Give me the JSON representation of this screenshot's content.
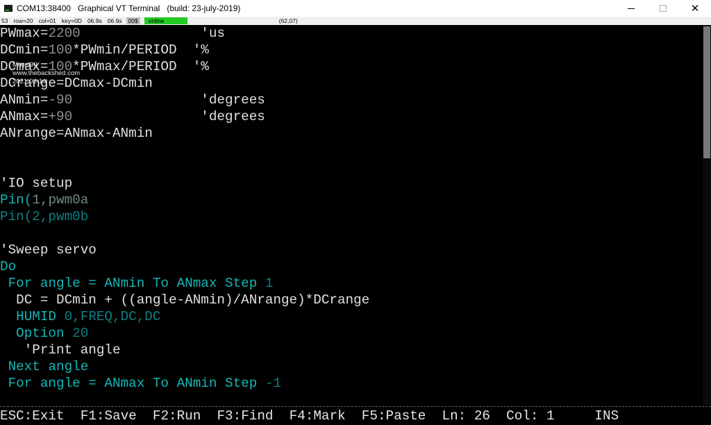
{
  "window": {
    "title": "COM13:38400   Graphical VT Terminal   (build: 23-july-2019)",
    "minimize": "",
    "maximize": "",
    "close": "✕"
  },
  "statusbar": {
    "items": [
      "53",
      "row=20",
      "col=01",
      "key=0D",
      "06.9s",
      "06.9s"
    ],
    "mode": "00$",
    "connection": "online",
    "cursor_pos": "(62,07)"
  },
  "watermark": {
    "author": "Mixtel90",
    "site": "www.thebackshed.com",
    "date": "2021-06-14"
  },
  "terminal": {
    "lines": [
      [
        {
          "t": "PWmax=",
          "c": "white"
        },
        {
          "t": "2200",
          "c": "gray"
        },
        {
          "t": "               'us",
          "c": "white"
        }
      ],
      [
        {
          "t": "DCmin=",
          "c": "white"
        },
        {
          "t": "100",
          "c": "gray"
        },
        {
          "t": "*PWmin/PERIOD",
          "c": "white"
        },
        {
          "t": "  '%",
          "c": "white"
        }
      ],
      [
        {
          "t": "DCmax=",
          "c": "white"
        },
        {
          "t": "100",
          "c": "gray"
        },
        {
          "t": "*PWmax/PERIOD",
          "c": "white"
        },
        {
          "t": "  '%",
          "c": "white"
        }
      ],
      [
        {
          "t": "DCrange=DCmax-DCmin",
          "c": "white"
        }
      ],
      [
        {
          "t": "ANmin=",
          "c": "white"
        },
        {
          "t": "-90",
          "c": "gray"
        },
        {
          "t": "                'degrees",
          "c": "white"
        }
      ],
      [
        {
          "t": "ANmax=",
          "c": "white"
        },
        {
          "t": "+90",
          "c": "gray"
        },
        {
          "t": "                'degrees",
          "c": "white"
        }
      ],
      [
        {
          "t": "ANrange=ANmax-ANmin",
          "c": "white"
        }
      ],
      [],
      [],
      [
        {
          "t": "'IO setup",
          "c": "white"
        }
      ],
      [
        {
          "t": "Pin(",
          "c": "cyan"
        },
        {
          "t": "1,pwm0a",
          "c": "mute"
        }
      ],
      [
        {
          "t": "Pin(2,pwm0b",
          "c": "dcyan"
        }
      ],
      [],
      [
        {
          "t": "'Sweep servo",
          "c": "white"
        }
      ],
      [
        {
          "t": "Do",
          "c": "cyan"
        }
      ],
      [
        {
          "t": " For ",
          "c": "cyan"
        },
        {
          "t": "angle = ANmin ",
          "c": "cyan"
        },
        {
          "t": "To ",
          "c": "cyan"
        },
        {
          "t": "ANmax ",
          "c": "cyan"
        },
        {
          "t": "Step ",
          "c": "cyan"
        },
        {
          "t": "1",
          "c": "dcyan"
        }
      ],
      [
        {
          "t": "  DC = DCmin + ((angle-ANmin)/ANrange)*DCrange",
          "c": "white"
        }
      ],
      [
        {
          "t": "  HUMID ",
          "c": "cyan"
        },
        {
          "t": "0,FREQ,DC,DC",
          "c": "dcyan"
        }
      ],
      [
        {
          "t": "  Option ",
          "c": "cyan"
        },
        {
          "t": "20",
          "c": "dcyan"
        }
      ],
      [
        {
          "t": "   'Print angle",
          "c": "white"
        }
      ],
      [
        {
          "t": " Next ",
          "c": "cyan"
        },
        {
          "t": "angle",
          "c": "cyan"
        }
      ],
      [
        {
          "t": " For ",
          "c": "cyan"
        },
        {
          "t": "angle = ANmax ",
          "c": "cyan"
        },
        {
          "t": "To ",
          "c": "cyan"
        },
        {
          "t": "ANmin ",
          "c": "cyan"
        },
        {
          "t": "Step ",
          "c": "cyan"
        },
        {
          "t": "-1",
          "c": "dcyan"
        }
      ]
    ]
  },
  "editor_bar": {
    "esc": "ESC:Exit",
    "f1": "F1:Save",
    "f2": "F2:Run",
    "f3": "F3:Find",
    "f4": "F4:Mark",
    "f5": "F5:Paste",
    "line": "Ln: 26",
    "col": "Col: 1",
    "mode": "INS"
  },
  "colors": {
    "background": "#000000",
    "white": "#e0e0e0",
    "gray": "#8f8f8f",
    "cyan": "#15b6b6",
    "dark_cyan": "#0f7e82",
    "online": "#22cc22"
  }
}
